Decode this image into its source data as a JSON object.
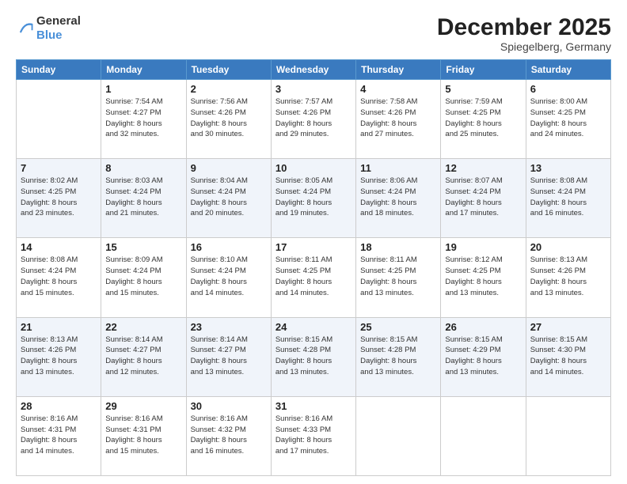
{
  "logo": {
    "general": "General",
    "blue": "Blue"
  },
  "header": {
    "title": "December 2025",
    "subtitle": "Spiegelberg, Germany"
  },
  "weekdays": [
    "Sunday",
    "Monday",
    "Tuesday",
    "Wednesday",
    "Thursday",
    "Friday",
    "Saturday"
  ],
  "weeks": [
    [
      {
        "day": "",
        "info": ""
      },
      {
        "day": "1",
        "info": "Sunrise: 7:54 AM\nSunset: 4:27 PM\nDaylight: 8 hours\nand 32 minutes."
      },
      {
        "day": "2",
        "info": "Sunrise: 7:56 AM\nSunset: 4:26 PM\nDaylight: 8 hours\nand 30 minutes."
      },
      {
        "day": "3",
        "info": "Sunrise: 7:57 AM\nSunset: 4:26 PM\nDaylight: 8 hours\nand 29 minutes."
      },
      {
        "day": "4",
        "info": "Sunrise: 7:58 AM\nSunset: 4:26 PM\nDaylight: 8 hours\nand 27 minutes."
      },
      {
        "day": "5",
        "info": "Sunrise: 7:59 AM\nSunset: 4:25 PM\nDaylight: 8 hours\nand 25 minutes."
      },
      {
        "day": "6",
        "info": "Sunrise: 8:00 AM\nSunset: 4:25 PM\nDaylight: 8 hours\nand 24 minutes."
      }
    ],
    [
      {
        "day": "7",
        "info": "Sunrise: 8:02 AM\nSunset: 4:25 PM\nDaylight: 8 hours\nand 23 minutes."
      },
      {
        "day": "8",
        "info": "Sunrise: 8:03 AM\nSunset: 4:24 PM\nDaylight: 8 hours\nand 21 minutes."
      },
      {
        "day": "9",
        "info": "Sunrise: 8:04 AM\nSunset: 4:24 PM\nDaylight: 8 hours\nand 20 minutes."
      },
      {
        "day": "10",
        "info": "Sunrise: 8:05 AM\nSunset: 4:24 PM\nDaylight: 8 hours\nand 19 minutes."
      },
      {
        "day": "11",
        "info": "Sunrise: 8:06 AM\nSunset: 4:24 PM\nDaylight: 8 hours\nand 18 minutes."
      },
      {
        "day": "12",
        "info": "Sunrise: 8:07 AM\nSunset: 4:24 PM\nDaylight: 8 hours\nand 17 minutes."
      },
      {
        "day": "13",
        "info": "Sunrise: 8:08 AM\nSunset: 4:24 PM\nDaylight: 8 hours\nand 16 minutes."
      }
    ],
    [
      {
        "day": "14",
        "info": "Sunrise: 8:08 AM\nSunset: 4:24 PM\nDaylight: 8 hours\nand 15 minutes."
      },
      {
        "day": "15",
        "info": "Sunrise: 8:09 AM\nSunset: 4:24 PM\nDaylight: 8 hours\nand 15 minutes."
      },
      {
        "day": "16",
        "info": "Sunrise: 8:10 AM\nSunset: 4:24 PM\nDaylight: 8 hours\nand 14 minutes."
      },
      {
        "day": "17",
        "info": "Sunrise: 8:11 AM\nSunset: 4:25 PM\nDaylight: 8 hours\nand 14 minutes."
      },
      {
        "day": "18",
        "info": "Sunrise: 8:11 AM\nSunset: 4:25 PM\nDaylight: 8 hours\nand 13 minutes."
      },
      {
        "day": "19",
        "info": "Sunrise: 8:12 AM\nSunset: 4:25 PM\nDaylight: 8 hours\nand 13 minutes."
      },
      {
        "day": "20",
        "info": "Sunrise: 8:13 AM\nSunset: 4:26 PM\nDaylight: 8 hours\nand 13 minutes."
      }
    ],
    [
      {
        "day": "21",
        "info": "Sunrise: 8:13 AM\nSunset: 4:26 PM\nDaylight: 8 hours\nand 13 minutes."
      },
      {
        "day": "22",
        "info": "Sunrise: 8:14 AM\nSunset: 4:27 PM\nDaylight: 8 hours\nand 12 minutes."
      },
      {
        "day": "23",
        "info": "Sunrise: 8:14 AM\nSunset: 4:27 PM\nDaylight: 8 hours\nand 13 minutes."
      },
      {
        "day": "24",
        "info": "Sunrise: 8:15 AM\nSunset: 4:28 PM\nDaylight: 8 hours\nand 13 minutes."
      },
      {
        "day": "25",
        "info": "Sunrise: 8:15 AM\nSunset: 4:28 PM\nDaylight: 8 hours\nand 13 minutes."
      },
      {
        "day": "26",
        "info": "Sunrise: 8:15 AM\nSunset: 4:29 PM\nDaylight: 8 hours\nand 13 minutes."
      },
      {
        "day": "27",
        "info": "Sunrise: 8:15 AM\nSunset: 4:30 PM\nDaylight: 8 hours\nand 14 minutes."
      }
    ],
    [
      {
        "day": "28",
        "info": "Sunrise: 8:16 AM\nSunset: 4:31 PM\nDaylight: 8 hours\nand 14 minutes."
      },
      {
        "day": "29",
        "info": "Sunrise: 8:16 AM\nSunset: 4:31 PM\nDaylight: 8 hours\nand 15 minutes."
      },
      {
        "day": "30",
        "info": "Sunrise: 8:16 AM\nSunset: 4:32 PM\nDaylight: 8 hours\nand 16 minutes."
      },
      {
        "day": "31",
        "info": "Sunrise: 8:16 AM\nSunset: 4:33 PM\nDaylight: 8 hours\nand 17 minutes."
      },
      {
        "day": "",
        "info": ""
      },
      {
        "day": "",
        "info": ""
      },
      {
        "day": "",
        "info": ""
      }
    ]
  ]
}
